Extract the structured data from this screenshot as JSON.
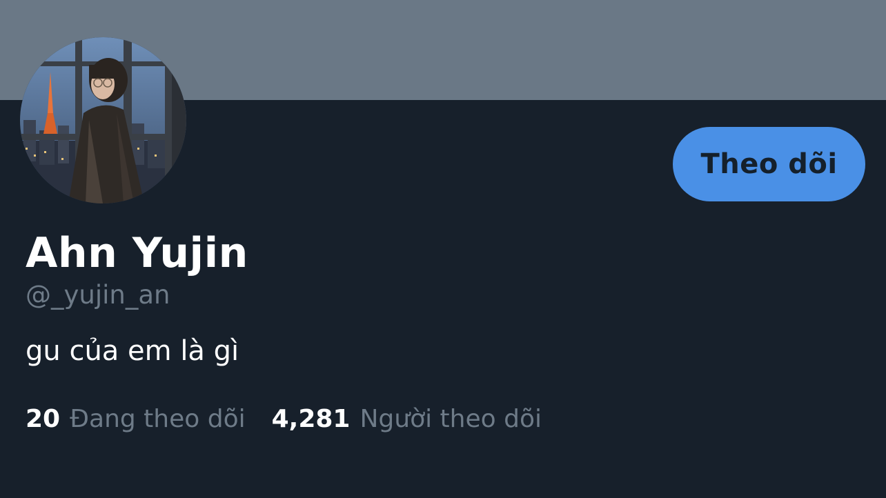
{
  "profile": {
    "display_name": "Ahn Yujin",
    "handle": "@_yujin_an",
    "bio": "gu của em là gì",
    "follow_button_label": "Theo dõi",
    "stats": {
      "following_count": "20",
      "following_label": "Đang theo dõi",
      "followers_count": "4,281",
      "followers_label": "Người theo dõi"
    }
  },
  "colors": {
    "background": "#17202b",
    "banner": "#6a7886",
    "accent": "#4a90e6",
    "muted_text": "#6e7b88"
  },
  "icons": {
    "avatar": "profile-photo"
  }
}
